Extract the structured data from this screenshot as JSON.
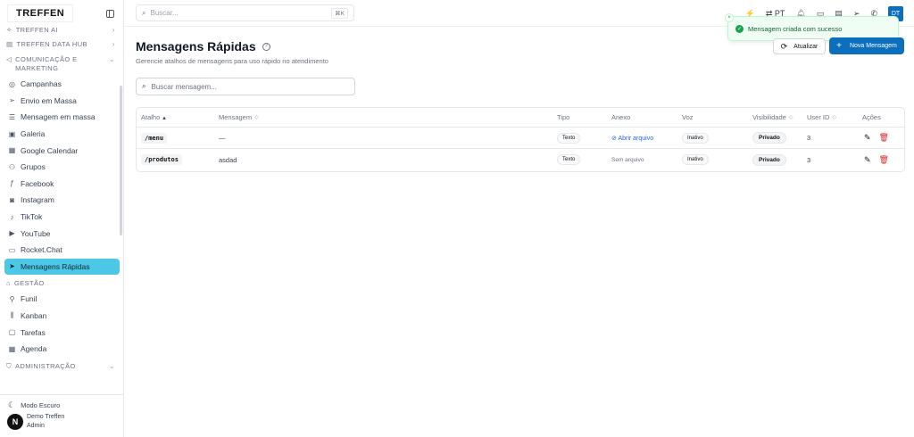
{
  "sidebar": {
    "logo": "TREFFEN",
    "sections": {
      "ai": "TREFFEN AI",
      "datahub": "TREFFEN DATA HUB",
      "comm": "COMUNICAÇÃO E MARKETING",
      "gestao": "GESTÃO",
      "admin": "ADMINISTRAÇÃO"
    },
    "items": {
      "campanhas": "Campanhas",
      "envio": "Envio em Massa",
      "mensagem_massa": "Mensagem em massa",
      "galeria": "Galeria",
      "gcal": "Google Calendar",
      "grupos": "Grupos",
      "facebook": "Facebook",
      "instagram": "Instagram",
      "tiktok": "TikTok",
      "youtube": "YouTube",
      "rocket": "Rocket.Chat",
      "mensagens_rapidas": "Mensagens Rápidas",
      "funil": "Funil",
      "kanban": "Kanban",
      "tarefas": "Tarefas",
      "agenda": "Agenda"
    },
    "footer": {
      "dark_mode": "Modo Escuro",
      "user_name": "Demo Treffen",
      "user_role": "Admin",
      "avatar_letter": "N"
    }
  },
  "topbar": {
    "search_placeholder": "Buscar...",
    "search_shortcut": "⌘K",
    "lang": "PT",
    "avatar": "DT"
  },
  "toast": {
    "message": "Mensagem criada com sucesso"
  },
  "page": {
    "title": "Mensagens Rápidas",
    "subtitle": "Gerencie atalhos de mensagens para uso rápido no atendimento",
    "refresh_label": "Atualizar",
    "new_label": "Nova Mensagem",
    "search_placeholder": "Buscar mensagem..."
  },
  "table": {
    "headers": {
      "atalho": "Atalho",
      "mensagem": "Mensagem",
      "tipo": "Tipo",
      "anexo": "Anexo",
      "voz": "Voz",
      "visibilidade": "Visibilidade",
      "user_id": "User ID",
      "acoes": "Ações"
    },
    "rows": [
      {
        "atalho": "/menu",
        "mensagem": "—",
        "tipo": "Texto",
        "anexo": "Abrir arquivo",
        "voz": "Inativo",
        "visibilidade": "Privado",
        "user_id": "3"
      },
      {
        "atalho": "/produtos",
        "mensagem": "asdad",
        "tipo": "Texto",
        "anexo": "Sem arquivo",
        "voz": "Inativo",
        "visibilidade": "Privado",
        "user_id": "3"
      }
    ]
  },
  "colors": {
    "accent": "#0c6fbd",
    "active_nav": "#4cc7e6",
    "success": "#16a34a",
    "danger": "#dc2626"
  }
}
